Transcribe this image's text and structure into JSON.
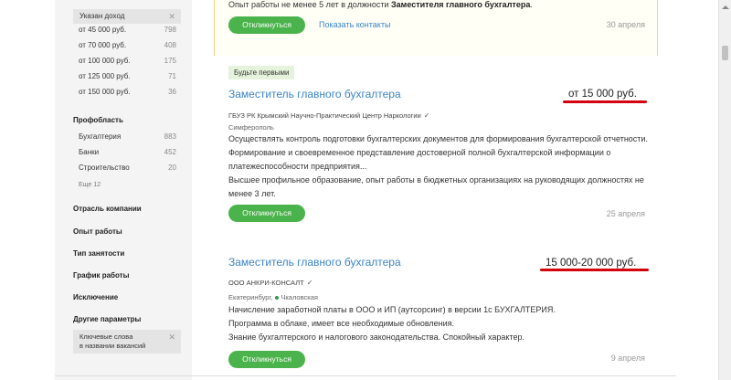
{
  "sidebar": {
    "active_chip": {
      "label": "Указан доход"
    },
    "income_options": [
      {
        "label": "от 45 000 руб.",
        "count": "798"
      },
      {
        "label": "от 70 000 руб.",
        "count": "408"
      },
      {
        "label": "от 100 000 руб.",
        "count": "175"
      },
      {
        "label": "от 125 000 руб.",
        "count": "71"
      },
      {
        "label": "от 150 000 руб.",
        "count": "36"
      }
    ],
    "profarea": {
      "title": "Профобласть",
      "items": [
        {
          "label": "Бухгалтерия",
          "count": "883"
        },
        {
          "label": "Банки",
          "count": "452"
        },
        {
          "label": "Строительство",
          "count": "20"
        }
      ],
      "more": "Еще 12"
    },
    "sections": [
      "Отрасль компании",
      "Опыт работы",
      "Тип занятости",
      "График работы",
      "Исключение",
      "Другие параметры"
    ],
    "keywords_chip": {
      "line1": "Ключевые слова",
      "line2": "в названии вакансий"
    }
  },
  "vacancies": [
    {
      "requirement_prefix": "Опыт работы не менее 5 лет в должности ",
      "requirement_bold": "Заместителя главного бухгалтера",
      "requirement_suffix": ".",
      "respond_label": "Откликнуться",
      "contacts_label": "Показать контакты",
      "date": "30 апреля"
    },
    {
      "badge": "Будьте первыми",
      "title": "Заместитель главного бухгалтера",
      "salary": "от 15 000 руб.",
      "employer": "ГБУЗ РК Крымский Научно-Практический Центр Наркологии",
      "city": "Симферополь",
      "desc_1": "Осуществлять контроль подготовки бухгалтерских документов для формирования бухгалтерской отчетности. Формирование и своевременное представление достоверной полной бухгалтерской информации о платежеспособности предприятия...",
      "desc_2": "Высшее профильное образование, опыт работы в бюджетных организациях на руководящих должностях не менее 3 лет.",
      "respond_label": "Откликнуться",
      "date": "25 апреля"
    },
    {
      "title": "Заместитель главного бухгалтера",
      "salary": "15 000-20 000 руб.",
      "employer": "ООО АНКРИ-КОНСАЛТ",
      "city": "Екатеринбург,",
      "metro": "Чкаловская",
      "desc_1": "Начисление заработной платы в ООО и ИП (аутсорсинг) в версии 1с БУХГАЛТЕРИЯ.",
      "desc_2": "Программа в облаке, имеет все необходимые обновления.",
      "desc_3": "Знание бухгалтерского и налогового законодательства. Спокойный характер.",
      "respond_label": "Откликнуться",
      "date": "9 апреля"
    }
  ],
  "colors": {
    "accent_green": "#4bb34b",
    "link_blue": "#3b85c6",
    "highlight_red": "#d3000f",
    "badge_bg": "#e6f3dc"
  },
  "icons": [
    "close-icon",
    "verified-check-icon",
    "metro-icon",
    "scroll-up-icon"
  ]
}
